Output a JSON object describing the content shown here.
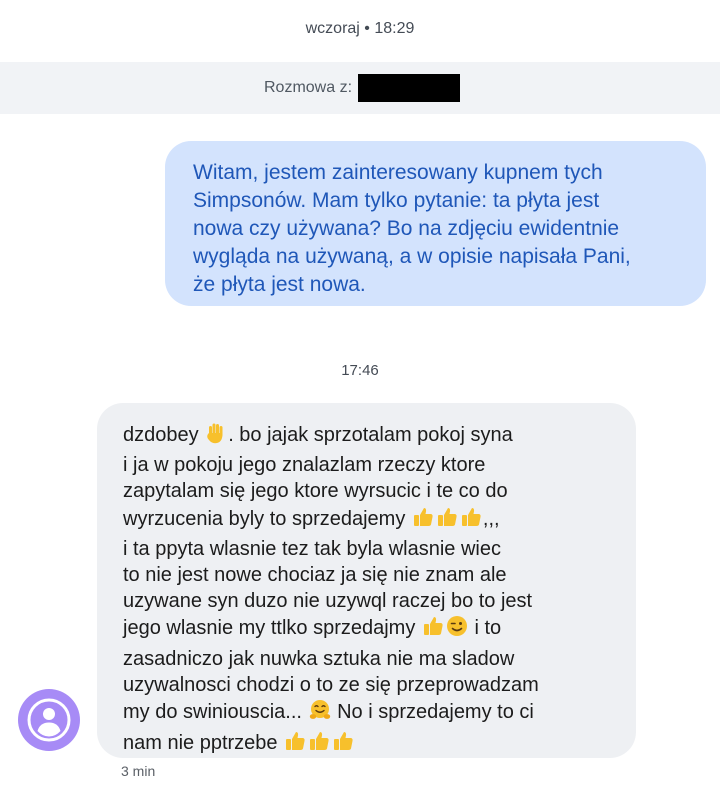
{
  "header": {
    "timestamp": "wczoraj • 18:29"
  },
  "conversation": {
    "label": "Rozmowa z:"
  },
  "outgoing_message": {
    "lines": [
      "Witam, jestem zainteresowany kupnem tych",
      "Simpsonów. Mam tylko pytanie: ta płyta jest",
      "nowa czy używana? Bo na zdjęciu ewidentnie",
      "wygląda na używaną, a w opisie napisała Pani,",
      "że płyta jest nowa."
    ]
  },
  "divider_time": "17:46",
  "incoming_message": {
    "l1a": "dzdobey",
    "l1b": ". bo jajak sprzotalam pokoj syna",
    "l2": "i ja w pokoju jego znalazlam rzeczy ktore",
    "l3": "zapytalam się jego ktore wyrsucic i te co do",
    "l4a": "wyrzucenia byly to sprzedajemy",
    "l4b": ",,,",
    "l5": "i ta ppyta wlasnie tez tak byla wlasnie wiec",
    "l6": "to nie jest nowe chociaz ja się nie znam ale",
    "l7": "uzywane syn duzo nie uzywql raczej bo to jest",
    "l8a": "jego wlasnie my ttlko sprzedajmy",
    "l8b": "i to",
    "l9": "zasadniczo jak nuwka sztuka nie ma sladow",
    "l10": "uzywalnosci chodzi o to ze się przeprowadzam",
    "l11a": "my do swiniouscia...",
    "l11b": "No i sprzedajemy to ci",
    "l12a": "nam nie pptrzebe"
  },
  "message_age": "3 min",
  "colors": {
    "outgoing_bubble": "#d3e3fd",
    "outgoing_text": "#1f57b8",
    "incoming_bubble": "#eef0f3",
    "avatar": "#a78bf6",
    "bar": "#f1f3f6"
  },
  "icons": [
    "raised-hand-icon",
    "thumbs-up-icon",
    "wink-face-icon",
    "hugging-face-icon",
    "person-icon"
  ]
}
